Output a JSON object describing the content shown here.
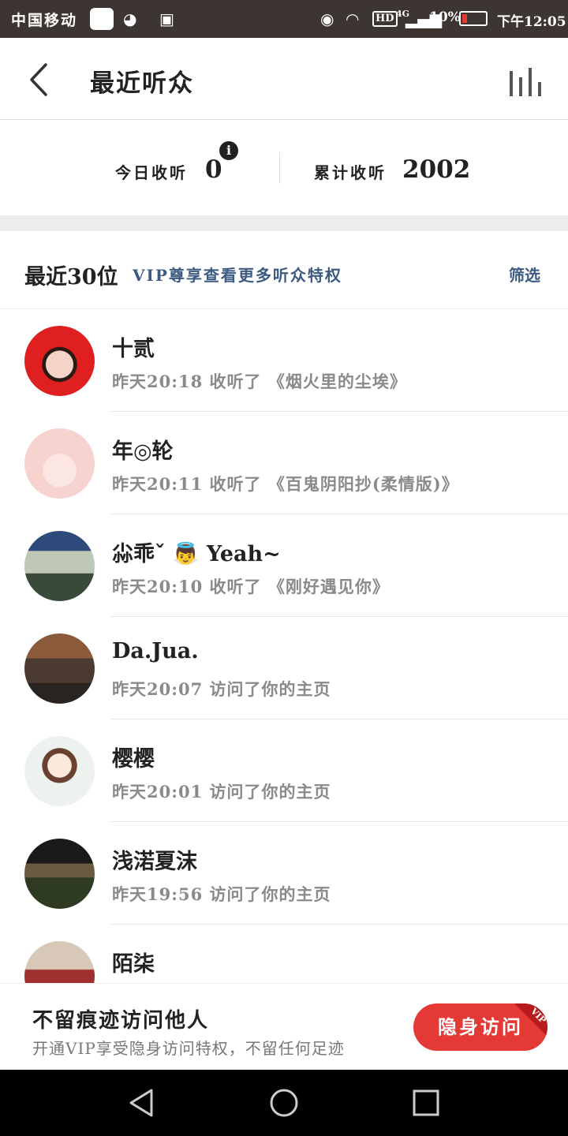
{
  "status_bar": {
    "carrier": "中国移动",
    "network": "4G",
    "battery": "10%",
    "time": "下午12:05"
  },
  "header": {
    "title": "最近听众"
  },
  "stats": {
    "today_label": "今日收听",
    "today_value": "0",
    "total_label": "累计收听",
    "total_value": "2002"
  },
  "section": {
    "title": "最近30位",
    "vip_text": "VIP尊享查看更多听众特权",
    "filter": "筛选"
  },
  "listeners": [
    {
      "name": "十贰",
      "activity": "昨天20:18  收听了 《烟火里的尘埃》"
    },
    {
      "name": "年◎轮",
      "activity": "昨天20:11  收听了 《百鬼阴阳抄(柔情版)》"
    },
    {
      "name": "尛乖ˇ  👼    Yeah~",
      "activity": "昨天20:10  收听了 《刚好遇见你》"
    },
    {
      "name": "Da.Jua.",
      "activity": "昨天20:07  访问了你的主页"
    },
    {
      "name": "樱樱",
      "activity": "昨天20:01  访问了你的主页"
    },
    {
      "name": "浅渃夏沫",
      "activity": "昨天19:56  访问了你的主页"
    },
    {
      "name": "陌柒",
      "activity": ""
    }
  ],
  "banner": {
    "title": "不留痕迹访问他人",
    "subtitle": "开通VIP享受隐身访问特权，不留任何足迹",
    "button": "隐身访问",
    "badge": "VIP"
  },
  "colors": {
    "accent_red": "#e53935",
    "link_blue": "#3d5a80",
    "status_bar": "#3d3532"
  }
}
